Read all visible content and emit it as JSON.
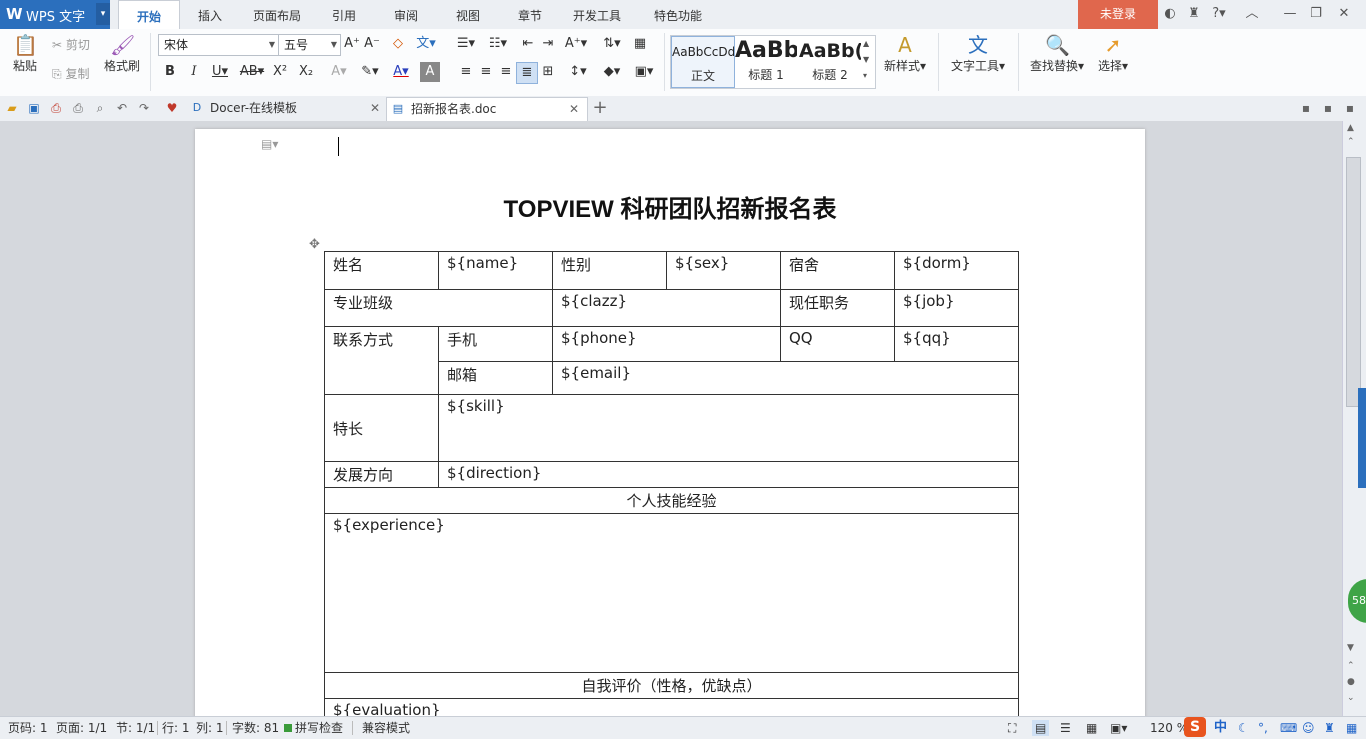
{
  "app": {
    "logo": "W",
    "name": "WPS 文字",
    "menu_arrow": "▾"
  },
  "menu_tabs": [
    "开始",
    "插入",
    "页面布局",
    "引用",
    "审阅",
    "视图",
    "章节",
    "开发工具",
    "特色功能"
  ],
  "active_menu_tab": "开始",
  "login_label": "未登录",
  "ribbon": {
    "paste": "粘贴",
    "cut": "剪切",
    "copy": "复制",
    "format_painter": "格式刷",
    "font_name": "宋体",
    "font_size": "五号",
    "styles": [
      {
        "sample": "AaBbCcDd",
        "caption": "正文"
      },
      {
        "sample": "AaBb",
        "caption": "标题 1"
      },
      {
        "sample": "AaBb(",
        "caption": "标题 2"
      }
    ],
    "new_style": "新样式",
    "text_tools": "文字工具",
    "find_replace": "查找替换",
    "select": "选择"
  },
  "doc_tabs": [
    {
      "label": "Docer-在线模板",
      "active": false
    },
    {
      "label": "招新报名表.doc",
      "active": true
    }
  ],
  "add_tab": "+",
  "document": {
    "title": "TOPVIEW 科研团队招新报名表",
    "rows": {
      "name_label": "姓名",
      "name_val": "${name}",
      "sex_label": "性别",
      "sex_val": "${sex}",
      "dorm_label": "宿舍",
      "dorm_val": "${dorm}",
      "major_label": "专业班级",
      "clazz_val": "${clazz}",
      "job_label": "现任职务",
      "job_val": "${job}",
      "contact_label": "联系方式",
      "phone_label": "手机",
      "phone_val": "${phone}",
      "qq_label": "QQ",
      "qq_val": "${qq}",
      "email_label": "邮箱",
      "email_val": "${email}",
      "skill_label": "特长",
      "skill_val": "${skill}",
      "direction_label": "发展方向",
      "direction_val": "${direction}",
      "exp_header": "个人技能经验",
      "exp_val": "${experience}",
      "eval_header": "自我评价（性格，优缺点）",
      "eval_val": "${evaluation}"
    }
  },
  "side_badge": "58",
  "status": {
    "page_no": "页码: 1",
    "pages": "页面: 1/1",
    "section": "节: 1/1",
    "row": "行: 1",
    "col": "列: 1",
    "word_count": "字数: 81",
    "spell_check": "拼写检查",
    "compat_mode": "兼容模式",
    "zoom": "120 %",
    "ime": "中"
  }
}
